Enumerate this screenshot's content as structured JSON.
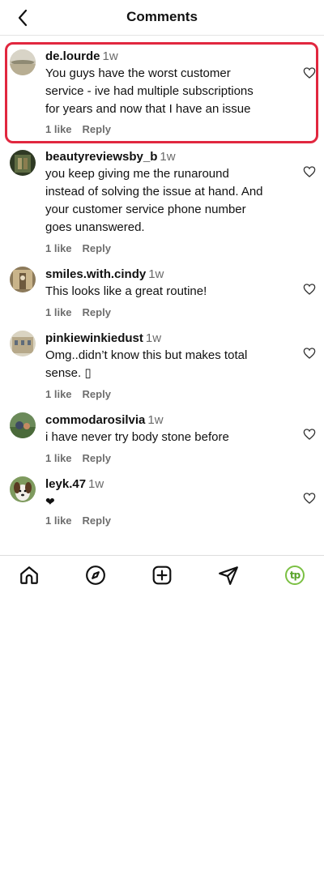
{
  "header": {
    "title": "Comments",
    "back_icon": "chevron-left-icon"
  },
  "comments": [
    {
      "username": "de.lourde",
      "time": "1w",
      "lines": [
        "You guys have the worst customer",
        "service - ive had multiple subscriptions",
        "for years and now that I have an issue"
      ],
      "likes": "1 like",
      "reply": "Reply",
      "highlighted": true
    },
    {
      "username": "beautyreviewsby_b",
      "time": "1w",
      "lines": [
        "you keep giving me the runaround",
        "instead of solving the issue at hand. And",
        "your customer service phone number",
        "goes unanswered."
      ],
      "likes": "1 like",
      "reply": "Reply"
    },
    {
      "username": "smiles.with.cindy",
      "time": "1w",
      "lines": [
        "This looks like a great routine!"
      ],
      "likes": "1 like",
      "reply": "Reply"
    },
    {
      "username": "pinkiewinkiedust",
      "time": "1w",
      "lines": [
        "Omg..didn’t know this but makes total",
        "sense. ▯"
      ],
      "likes": "1 like",
      "reply": "Reply"
    },
    {
      "username": "commodarosilvia",
      "time": "1w",
      "lines": [
        "i have never try body stone before"
      ],
      "likes": "1 like",
      "reply": "Reply"
    },
    {
      "username": "leyk.47",
      "time": "1w",
      "lines": [
        "❤"
      ],
      "likes": "1 like",
      "reply": "Reply"
    }
  ],
  "bottom_nav": {
    "items": [
      "home-icon",
      "explore-compass-icon",
      "create-plus-icon",
      "direct-send-icon",
      "profile-tp-logo"
    ],
    "profile_logo_text": "tp"
  },
  "colors": {
    "highlight": "#e1273f",
    "logo_green": "#7bc043"
  }
}
